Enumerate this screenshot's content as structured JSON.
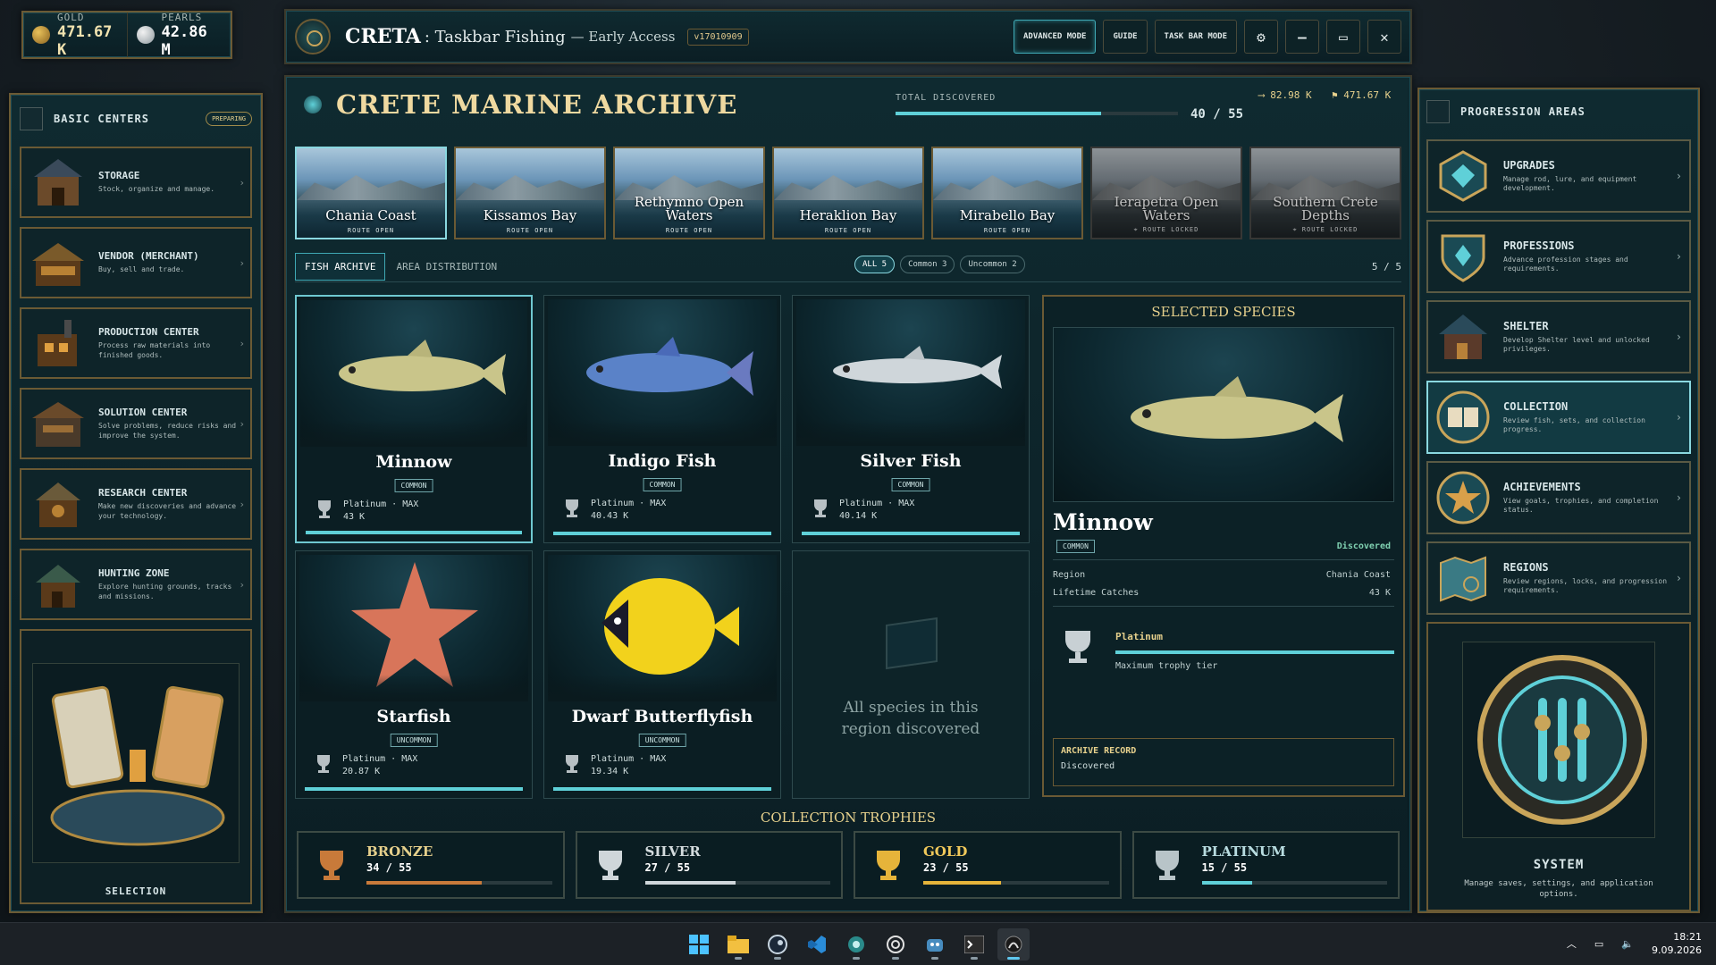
{
  "currency": {
    "gold_label": "GOLD",
    "gold_value": "471.67 K",
    "pearls_label": "PEARLS",
    "pearls_value": "42.86 M"
  },
  "titlebar": {
    "app_name": "CRETA",
    "app_subtitle": ": Taskbar Fishing",
    "app_edition": "— Early Access",
    "version": "v17010909",
    "buttons": [
      "ADVANCED MODE",
      "GUIDE",
      "TASK BAR MODE"
    ]
  },
  "left": {
    "title": "BASIC CENTERS",
    "badge": "PREPARING",
    "items": [
      {
        "name": "STORAGE",
        "desc": "Stock, organize and manage."
      },
      {
        "name": "VENDOR (MERCHANT)",
        "desc": "Buy, sell and trade."
      },
      {
        "name": "PRODUCTION CENTER",
        "desc": "Process raw materials into finished goods."
      },
      {
        "name": "SOLUTION CENTER",
        "desc": "Solve problems, reduce risks and improve the system."
      },
      {
        "name": "RESEARCH CENTER",
        "desc": "Make new discoveries and advance your technology."
      },
      {
        "name": "HUNTING ZONE",
        "desc": "Explore hunting grounds, tracks and missions."
      }
    ],
    "selection_label": "SELECTION"
  },
  "archive": {
    "title": "CRETE MARINE ARCHIVE",
    "discovered_label": "TOTAL DISCOVERED",
    "discovered_count": "40 / 55",
    "discovered_fraction": 0.727,
    "mini1": "82.98 K",
    "mini2": "471.67 K",
    "regions": [
      {
        "name": "Chania Coast",
        "status": "ROUTE OPEN"
      },
      {
        "name": "Kissamos Bay",
        "status": "ROUTE OPEN"
      },
      {
        "name": "Rethymno Open Waters",
        "status": "ROUTE OPEN"
      },
      {
        "name": "Heraklion Bay",
        "status": "ROUTE OPEN"
      },
      {
        "name": "Mirabello Bay",
        "status": "ROUTE OPEN"
      },
      {
        "name": "Ierapetra Open Waters",
        "status": "⌖ ROUTE LOCKED"
      },
      {
        "name": "Southern Crete Depths",
        "status": "⌖ ROUTE LOCKED"
      }
    ],
    "tabs": [
      "FISH ARCHIVE",
      "AREA DISTRIBUTION"
    ],
    "chips": [
      "ALL 5",
      "Common 3",
      "Uncommon 2"
    ],
    "count": "5 / 5"
  },
  "fish": [
    {
      "name": "Minnow",
      "rarity": "COMMON",
      "tier": "Platinum · MAX",
      "value": "43 K",
      "color": "#c9c58a"
    },
    {
      "name": "Indigo Fish",
      "rarity": "COMMON",
      "tier": "Platinum · MAX",
      "value": "40.43 K",
      "color": "#5a82c8"
    },
    {
      "name": "Silver Fish",
      "rarity": "COMMON",
      "tier": "Platinum · MAX",
      "value": "40.14 K",
      "color": "#cfd6da"
    },
    {
      "name": "Starfish",
      "rarity": "UNCOMMON",
      "tier": "Platinum · MAX",
      "value": "20.87 K",
      "color": "#d8755a"
    },
    {
      "name": "Dwarf Butterflyfish",
      "rarity": "UNCOMMON",
      "tier": "Platinum · MAX",
      "value": "19.34 K",
      "color": "#f2d21c"
    }
  ],
  "empty_msg": "All species in this region discovered",
  "detail": {
    "head": "SELECTED SPECIES",
    "name": "Minnow",
    "rarity": "COMMON",
    "status": "Discovered",
    "region_label": "Region",
    "region_value": "Chania Coast",
    "catches_label": "Lifetime Catches",
    "catches_value": "43 K",
    "tier": "Platinum",
    "tier_desc": "Maximum trophy tier",
    "record_label": "ARCHIVE RECORD",
    "record_value": "Discovered"
  },
  "trophies": {
    "head": "COLLECTION TROPHIES",
    "items": [
      {
        "name": "BRONZE",
        "count": "34 / 55",
        "fraction": 0.62,
        "color": "#c87a3a"
      },
      {
        "name": "SILVER",
        "count": "27 / 55",
        "fraction": 0.49,
        "color": "#cfd6da"
      },
      {
        "name": "GOLD",
        "count": "23 / 55",
        "fraction": 0.42,
        "color": "#e6b43a"
      },
      {
        "name": "PLATINUM",
        "count": "15 / 55",
        "fraction": 0.27,
        "color": "#5fd0d8"
      }
    ]
  },
  "right": {
    "title": "PROGRESSION AREAS",
    "items": [
      {
        "name": "UPGRADES",
        "desc": "Manage rod, lure, and equipment development."
      },
      {
        "name": "PROFESSIONS",
        "desc": "Advance profession stages and requirements."
      },
      {
        "name": "SHELTER",
        "desc": "Develop Shelter level and unlocked privileges."
      },
      {
        "name": "COLLECTION",
        "desc": "Review fish, sets, and collection progress."
      },
      {
        "name": "ACHIEVEMENTS",
        "desc": "View goals, trophies, and completion status."
      },
      {
        "name": "REGIONS",
        "desc": "Review regions, locks, and progression requirements."
      }
    ],
    "system_title": "SYSTEM",
    "system_desc": "Manage saves, settings, and application options."
  },
  "taskbar": {
    "time": "18:21",
    "date": "9.09.2026"
  }
}
